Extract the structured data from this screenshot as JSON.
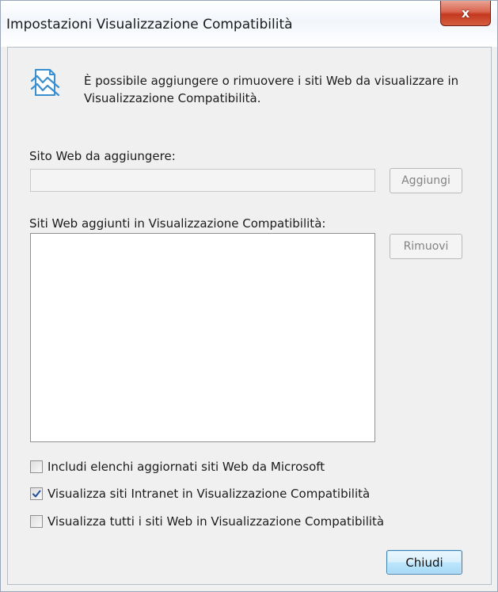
{
  "window": {
    "title": "Impostazioni Visualizzazione Compatibilità",
    "close_glyph": "x"
  },
  "info": {
    "icon": "compatibility-view-icon",
    "text": "È possibile aggiungere o rimuovere i siti Web da visualizzare in Visualizzazione Compatibilità."
  },
  "add_site": {
    "label": "Sito Web da aggiungere:",
    "value": "",
    "button": "Aggiungi"
  },
  "site_list": {
    "label": "Siti Web aggiunti in Visualizzazione Compatibilità:",
    "items": [],
    "remove_button": "Rimuovi"
  },
  "options": [
    {
      "label": "Includi elenchi aggiornati siti Web da Microsoft",
      "checked": false
    },
    {
      "label": "Visualizza siti Intranet in Visualizzazione Compatibilità",
      "checked": true
    },
    {
      "label": "Visualizza tutti i siti Web in Visualizzazione Compatibilità",
      "checked": false
    }
  ],
  "footer": {
    "close_button": "Chiudi"
  },
  "colors": {
    "close_button_red": "#c4381f",
    "default_button_border": "#3c7fb1",
    "dialog_background": "#f0f0f0"
  }
}
